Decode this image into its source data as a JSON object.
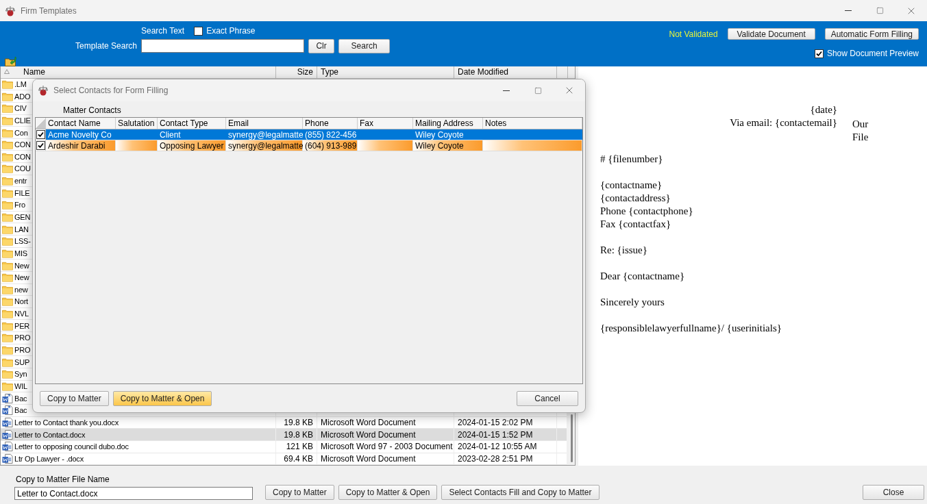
{
  "window": {
    "title": "Firm Templates"
  },
  "toolbar": {
    "search_text_label": "Search Text",
    "exact_phrase": {
      "label": "Exact Phrase",
      "checked": false
    },
    "template_search_label": "Template Search",
    "clear_button": "Clr",
    "search_button": "Search",
    "validation_status": "Not Validated",
    "validate_button": "Validate Document",
    "auto_fill_button": "Automatic Form Filling",
    "show_preview": {
      "label": "Show Document Preview",
      "checked": true
    }
  },
  "file_list": {
    "columns": [
      "Name",
      "Size",
      "Type",
      "Date Modified"
    ],
    "rows": [
      {
        "kind": "folder",
        "name": ".LM",
        "selected": false
      },
      {
        "kind": "folder",
        "name": "ADO",
        "selected": false
      },
      {
        "kind": "folder",
        "name": "CIV",
        "selected": false
      },
      {
        "kind": "folder",
        "name": "CLIE",
        "selected": false
      },
      {
        "kind": "folder",
        "name": "Con",
        "selected": false
      },
      {
        "kind": "folder",
        "name": "CON",
        "selected": false
      },
      {
        "kind": "folder",
        "name": "CON",
        "selected": false
      },
      {
        "kind": "folder",
        "name": "COU",
        "selected": false
      },
      {
        "kind": "folder",
        "name": "entr",
        "selected": false
      },
      {
        "kind": "folder",
        "name": "FILE",
        "selected": false
      },
      {
        "kind": "folder",
        "name": "Fro",
        "selected": false
      },
      {
        "kind": "folder",
        "name": "GEN",
        "selected": false
      },
      {
        "kind": "folder",
        "name": "LAN",
        "selected": false
      },
      {
        "kind": "folder",
        "name": "LSS-",
        "selected": false
      },
      {
        "kind": "folder",
        "name": "MIS",
        "selected": false
      },
      {
        "kind": "folder",
        "name": "New",
        "selected": false
      },
      {
        "kind": "folder",
        "name": "New",
        "selected": false
      },
      {
        "kind": "folder",
        "name": "new",
        "selected": false
      },
      {
        "kind": "folder",
        "name": "Nort",
        "selected": false
      },
      {
        "kind": "folder",
        "name": "NVL",
        "selected": false
      },
      {
        "kind": "folder",
        "name": "PER",
        "selected": false
      },
      {
        "kind": "folder",
        "name": "PRO",
        "selected": false
      },
      {
        "kind": "folder",
        "name": "PRO",
        "selected": false
      },
      {
        "kind": "folder",
        "name": "SUP",
        "selected": false
      },
      {
        "kind": "folder",
        "name": "Syn",
        "selected": false
      },
      {
        "kind": "folder",
        "name": "WIL",
        "selected": false
      },
      {
        "kind": "backup",
        "name": "Bac",
        "selected": false
      },
      {
        "kind": "backup",
        "name": "Bac",
        "selected": false
      },
      {
        "kind": "word",
        "name": "Letter to Contact thank you.docx",
        "size": "19.8 KB",
        "type": "Microsoft Word Document",
        "date_modified": "2024-01-15 2:02 PM",
        "selected": false
      },
      {
        "kind": "word",
        "name": "Letter to Contact.docx",
        "size": "19.8 KB",
        "type": "Microsoft Word Document",
        "date_modified": "2024-01-15 1:52 PM",
        "selected": true
      },
      {
        "kind": "word",
        "name": "Letter to opposing council dubo.doc",
        "size": "121 KB",
        "type": "Microsoft Word 97 - 2003 Document",
        "date_modified": "2024-01-12 10:55 AM",
        "selected": false
      },
      {
        "kind": "word",
        "name": "Ltr Op Lawyer - .docx",
        "size": "69.4 KB",
        "type": "Microsoft Word Document",
        "date_modified": "2023-02-28 2:51 PM",
        "selected": false
      }
    ]
  },
  "preview": {
    "header_right": [
      "{date}",
      "Via email: {contactemail}"
    ],
    "side_note": "Our File",
    "paragraphs": [
      [
        "# {filenumber}"
      ],
      [
        "{contactname}",
        "{contactaddress}",
        "Phone {contactphone}",
        "Fax {contactfax}"
      ],
      [
        "Re: {issue}"
      ],
      [
        "Dear {contactname}"
      ],
      [
        "Sincerely yours"
      ],
      [
        "{responsiblelawyerfullname}/ {userinitials}"
      ]
    ]
  },
  "bottom_bar": {
    "file_name_label": "Copy to Matter File Name",
    "file_name": "Letter to Contact.docx",
    "buttons": [
      "Copy to Matter",
      "Copy to Matter & Open",
      "Select Contacts Fill and Copy to Matter"
    ],
    "close_button": "Close"
  },
  "dialog": {
    "title": "Select Contacts for Form Filling",
    "section_label": "Matter Contacts",
    "columns": [
      "Contact Name",
      "Salutation",
      "Contact Type",
      "Email",
      "Phone",
      "Fax",
      "Mailing Address",
      "Notes"
    ],
    "rows": [
      {
        "checked": true,
        "selected": true,
        "contact_name": "Acme Novelty Co",
        "contact_type": "Client",
        "email": "synergy@legalmatte",
        "phone": "(855) 822-456",
        "mailing_address": "Wiley Coyote"
      },
      {
        "checked": true,
        "selected": false,
        "contact_name": "Ardeshir Darabi",
        "contact_type": "Opposing Lawyer",
        "email": "synergy@legalmatte",
        "phone": "(604) 913-989",
        "mailing_address": "Wiley Coyote"
      }
    ],
    "buttons": [
      {
        "label": "Copy to Matter",
        "default": false
      },
      {
        "label": "Copy to Matter & Open",
        "default": true
      }
    ],
    "cancel_button": "Cancel"
  }
}
